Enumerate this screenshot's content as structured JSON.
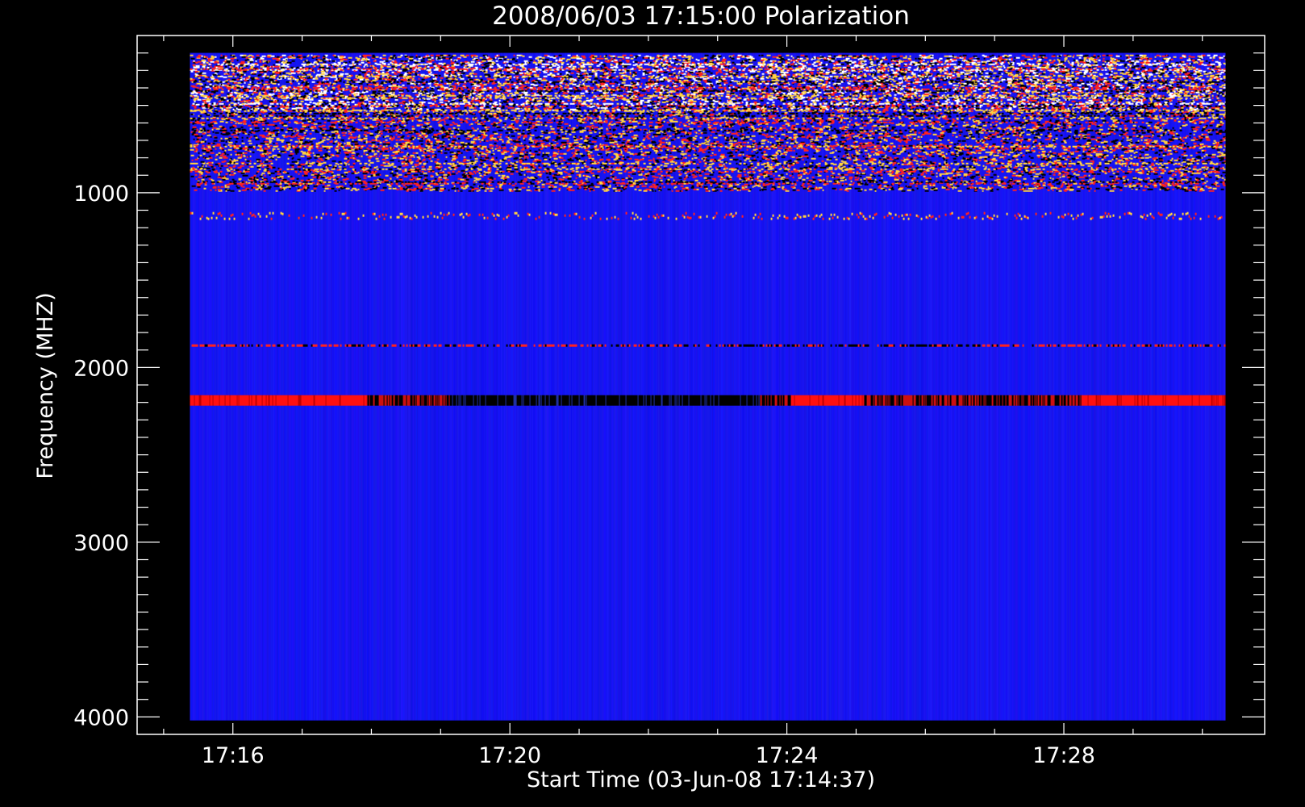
{
  "chart_data": {
    "type": "heatmap",
    "title": "2008/06/03 17:15:00 Polarization",
    "xlabel": "Start Time (03-Jun-08 17:14:37)",
    "ylabel": "Frequency (MHZ)",
    "x_tick_labels": [
      "17:16",
      "17:20",
      "17:24",
      "17:28"
    ],
    "y_tick_labels": [
      "1000",
      "2000",
      "3000",
      "4000"
    ],
    "y_ticks": [
      1000,
      2000,
      3000,
      4000
    ],
    "x_ticks_minutes": [
      16,
      20,
      24,
      28
    ],
    "xlim_minutes": [
      14.617,
      30.9
    ],
    "image_x_range_minutes": [
      15.38,
      30.33
    ],
    "ylim": [
      100,
      4100
    ],
    "image_y_range": [
      200,
      4020
    ],
    "y_inverted": true,
    "background_color": "#1a1aff",
    "features": [
      {
        "frequency_range": [
          210,
          530
        ],
        "description": "dense RFI rows",
        "colors": [
          "#ff2020",
          "#ffd040",
          "#ffffff",
          "#000000"
        ]
      },
      {
        "frequency_range": [
          530,
          990
        ],
        "description": "sparse RFI rows",
        "colors": [
          "#ff2020",
          "#ffd040",
          "#000000"
        ]
      },
      {
        "frequency": 1130,
        "description": "intermittent speckle line",
        "colors": [
          "#ff2020",
          "#ffd040"
        ]
      },
      {
        "frequency": 1870,
        "description": "red/dark band",
        "colors": [
          "#ff2020",
          "#000000"
        ]
      },
      {
        "frequency_range": [
          2160,
          2220
        ],
        "description": "strong band, red at ends, dark in middle",
        "colors": [
          "#ff1010",
          "#000000"
        ]
      }
    ]
  }
}
